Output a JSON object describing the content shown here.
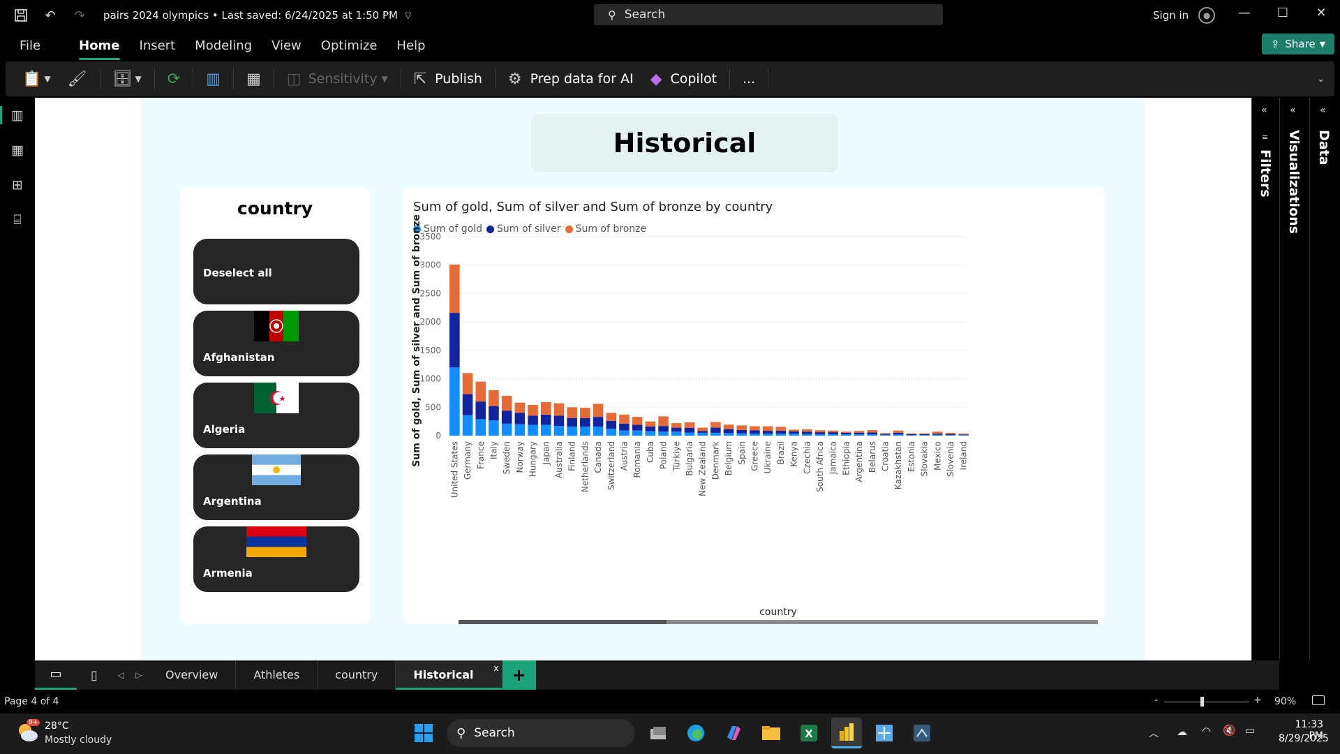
{
  "titlebar": {
    "doc_title": "pairs 2024 olympics • Last saved: 6/24/2025 at 1:50 PM",
    "search_placeholder": "Search",
    "signin": "Sign in"
  },
  "menu": [
    "File",
    "Home",
    "Insert",
    "Modeling",
    "View",
    "Optimize",
    "Help"
  ],
  "share_label": "Share",
  "ribbon": {
    "sensitivity": "Sensitivity",
    "publish": "Publish",
    "prep_data": "Prep data for AI",
    "copilot": "Copilot",
    "more": "..."
  },
  "report": {
    "page_title": "Historical",
    "slicer": {
      "title": "country",
      "items": [
        "Deselect all",
        "Afghanistan",
        "Algeria",
        "Argentina",
        "Armenia"
      ]
    }
  },
  "panes": {
    "filters": "Filters",
    "visualizations": "Visualizations",
    "data": "Data"
  },
  "tabs": [
    "Overview",
    "Athletes",
    "country",
    "Historical"
  ],
  "tab_close": "x",
  "status": {
    "page": "Page 4 of 4",
    "zoom": "90%",
    "minus": "-",
    "plus": "+"
  },
  "taskbar": {
    "temp": "28°C",
    "weather": "Mostly cloudy",
    "badge": "9+",
    "search": "Search",
    "time": "11:33 PM",
    "date": "8/29/2025"
  },
  "colors": {
    "gold": "#118dff",
    "silver": "#12239e",
    "bronze": "#e66c37",
    "accent": "#1aa37a"
  },
  "chart_data": {
    "type": "bar",
    "stacked": true,
    "title": "Sum of gold, Sum of silver and Sum of bronze by country",
    "xlabel": "country",
    "ylabel": "Sum of gold, Sum of silver and Sum of bronze",
    "ylim": [
      0,
      3500
    ],
    "yticks": [
      0,
      500,
      1000,
      1500,
      2000,
      2500,
      3000,
      3500
    ],
    "categories": [
      "United States",
      "Germany",
      "France",
      "Italy",
      "Sweden",
      "Norway",
      "Hungary",
      "Japan",
      "Australia",
      "Finland",
      "Netherlands",
      "Canada",
      "Switzerland",
      "Austria",
      "Romania",
      "Cuba",
      "Poland",
      "Türkiye",
      "Bulgaria",
      "New Zealand",
      "Denmark",
      "Belgium",
      "Spain",
      "Greece",
      "Ukraine",
      "Brazil",
      "Kenya",
      "Czechia",
      "South Africa",
      "Jamaica",
      "Ethiopia",
      "Argentina",
      "Belarus",
      "Croatia",
      "Kazakhstan",
      "Estonia",
      "Slovakia",
      "Mexico",
      "Slovenia",
      "Ireland"
    ],
    "series": [
      {
        "name": "Sum of gold",
        "values": [
          1200,
          360,
          290,
          270,
          210,
          200,
          190,
          190,
          170,
          160,
          160,
          160,
          120,
          90,
          90,
          80,
          70,
          70,
          55,
          50,
          50,
          45,
          40,
          35,
          35,
          35,
          35,
          30,
          25,
          25,
          25,
          22,
          22,
          15,
          20,
          10,
          10,
          15,
          10,
          10
        ]
      },
      {
        "name": "Sum of silver",
        "values": [
          960,
          370,
          310,
          250,
          230,
          200,
          160,
          180,
          180,
          150,
          150,
          170,
          140,
          120,
          100,
          80,
          100,
          70,
          80,
          30,
          90,
          70,
          60,
          60,
          50,
          50,
          40,
          40,
          35,
          35,
          25,
          30,
          35,
          15,
          30,
          15,
          15,
          20,
          15,
          10
        ]
      },
      {
        "name": "Sum of bronze",
        "values": [
          850,
          370,
          350,
          280,
          260,
          180,
          190,
          220,
          220,
          190,
          180,
          230,
          140,
          160,
          140,
          90,
          170,
          80,
          100,
          60,
          100,
          80,
          80,
          70,
          80,
          70,
          30,
          40,
          35,
          30,
          20,
          30,
          40,
          15,
          40,
          15,
          15,
          35,
          25,
          15
        ]
      }
    ]
  }
}
